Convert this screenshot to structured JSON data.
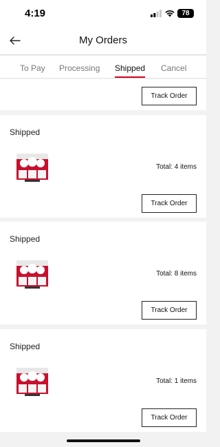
{
  "status_bar": {
    "time": "4:19",
    "battery": "78"
  },
  "header": {
    "title": "My Orders"
  },
  "tabs": [
    {
      "label": "To Pay",
      "active": false
    },
    {
      "label": "Processing",
      "active": false
    },
    {
      "label": "Shipped",
      "active": true
    },
    {
      "label": "Cancel",
      "active": false
    }
  ],
  "orders": [
    {
      "status": "",
      "total": "",
      "button": "Track Order"
    },
    {
      "status": "Shipped",
      "total": "Total: 4 items",
      "button": "Track Order"
    },
    {
      "status": "Shipped",
      "total": "Total: 8 items",
      "button": "Track Order"
    },
    {
      "status": "Shipped",
      "total": "Total: 1 items",
      "button": "Track Order"
    }
  ],
  "colors": {
    "accent": "#d0021b",
    "background": "#f2f2f2",
    "card": "#ffffff"
  },
  "icons": [
    "back-arrow-icon",
    "signal-icon",
    "wifi-icon",
    "battery-icon"
  ]
}
